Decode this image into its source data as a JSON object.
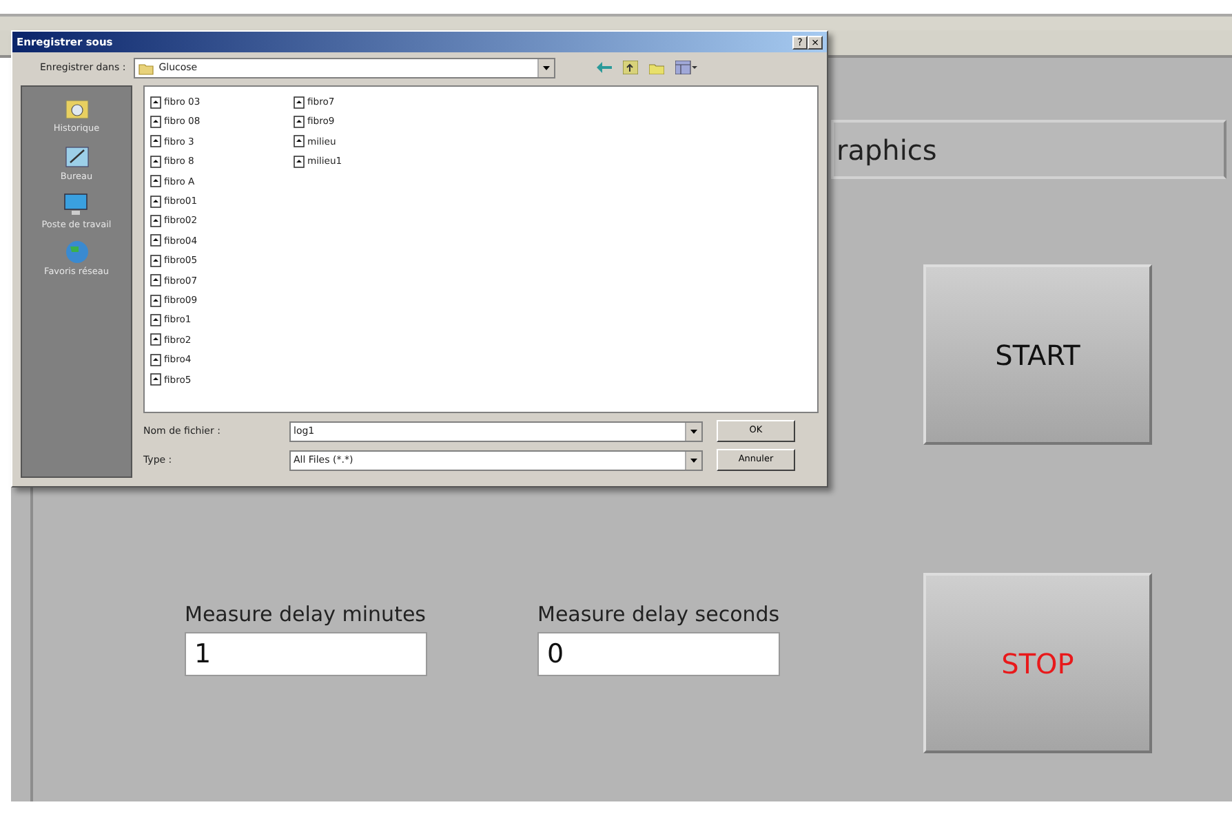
{
  "app": {
    "tab": "raphics",
    "fields": [
      {
        "label": "Measure delay minutes",
        "value": "1"
      },
      {
        "label": "Measure delay seconds",
        "value": "0"
      }
    ],
    "buttons": [
      {
        "label": "START",
        "kind": "start"
      },
      {
        "label": "STOP",
        "kind": "stop"
      }
    ]
  },
  "dialog": {
    "title": "Enregistrer sous",
    "title_buttons": [
      "?",
      "×"
    ],
    "save_in": {
      "label": "Enregistrer dans :",
      "value": "Glucose"
    },
    "places": [
      {
        "label": "Historique",
        "kind": "history"
      },
      {
        "label": "Bureau",
        "kind": "desktop"
      },
      {
        "label": "Poste de travail",
        "kind": "computer"
      },
      {
        "label": "Favoris réseau",
        "kind": "network"
      }
    ],
    "files": [
      "fibro 03",
      "fibro 08",
      "fibro 3",
      "fibro 8",
      "fibro A",
      "fibro01",
      "fibro02",
      "fibro04",
      "fibro05",
      "fibro07",
      "fibro09",
      "fibro1",
      "fibro2",
      "fibro4",
      "fibro5",
      "fibro7",
      "fibro9",
      "milieu",
      "milieu1"
    ],
    "filename": {
      "label": "Nom de fichier :",
      "value": "log1"
    },
    "type": {
      "label": "Type :",
      "value": "All Files (*.*)"
    },
    "buttons": [
      "OK",
      "Annuler"
    ]
  }
}
